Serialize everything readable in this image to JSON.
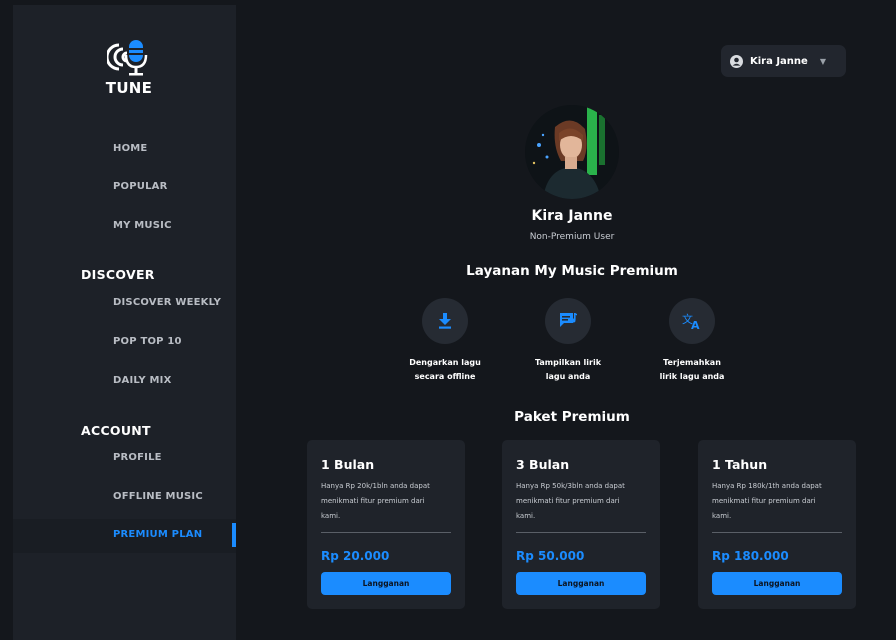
{
  "app": {
    "logo_text": "TUNE"
  },
  "sidebar": {
    "items": [
      {
        "label": "HOME"
      },
      {
        "label": "POPULAR"
      },
      {
        "label": "MY MUSIC"
      }
    ],
    "discover": {
      "heading": "DISCOVER",
      "items": [
        {
          "label": "DISCOVER WEEKLY"
        },
        {
          "label": "POP TOP 10"
        },
        {
          "label": "DAILY MIX"
        }
      ]
    },
    "account": {
      "heading": "ACCOUNT",
      "items": [
        {
          "label": "PROFILE"
        },
        {
          "label": "OFFLINE MUSIC"
        },
        {
          "label": "PREMIUM PLAN",
          "active": true
        }
      ]
    }
  },
  "header": {
    "user_name": "Kira Janne",
    "user_icon": "user-circle-icon",
    "chevron_icon": "chevron-down-icon"
  },
  "profile": {
    "name": "Kira Janne",
    "status": "Non-Premium User"
  },
  "services": {
    "title": "Layanan My Music Premium",
    "features": [
      {
        "icon": "download-icon",
        "line1": "Dengarkan lagu",
        "line2": "secara offline"
      },
      {
        "icon": "lyrics-icon",
        "line1": "Tampilkan lirik",
        "line2": "lagu anda"
      },
      {
        "icon": "translate-icon",
        "line1": "Terjemahkan",
        "line2": "lirik lagu anda"
      }
    ]
  },
  "plans": {
    "title": "Paket Premium",
    "items": [
      {
        "title": "1 Bulan",
        "desc1": "Hanya Rp 20k/1bln anda dapat",
        "desc2": "menikmati fitur premium dari",
        "desc3": "kami.",
        "price": "Rp 20.000",
        "button": "Langganan"
      },
      {
        "title": "3 Bulan",
        "desc1": "Hanya Rp 50k/3bln anda dapat",
        "desc2": "menikmati fitur premium dari",
        "desc3": "kami.",
        "price": "Rp 50.000",
        "button": "Langganan"
      },
      {
        "title": "1 Tahun",
        "desc1": "Hanya Rp 180k/1th anda dapat",
        "desc2": "menikmati fitur premium dari",
        "desc3": "kami.",
        "price": "Rp 180.000",
        "button": "Langganan"
      }
    ]
  },
  "colors": {
    "accent": "#1b8cff",
    "sidebar_bg": "#1d2128",
    "main_bg": "#14171c",
    "card_bg": "#1f232a"
  }
}
